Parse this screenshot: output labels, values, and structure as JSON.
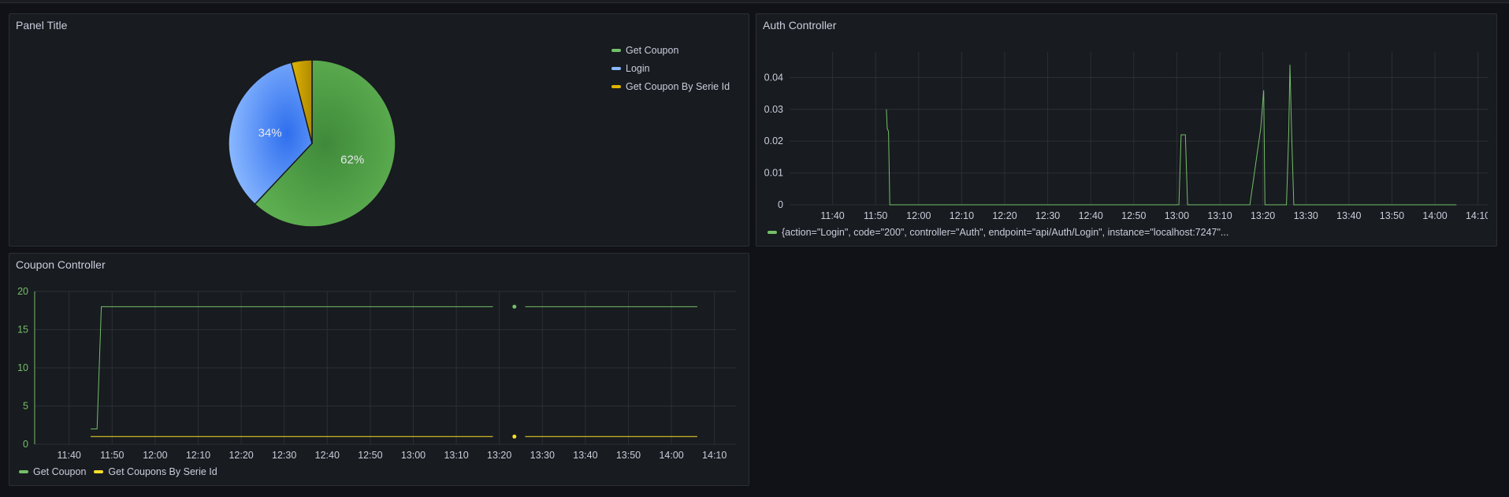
{
  "colors": {
    "green": "#73bf69",
    "blue": "#5794f2",
    "yellow": "#fade2a",
    "grid": "#2c2f36",
    "axisText": "#ccccdc"
  },
  "panels": {
    "pie": {
      "title": "Panel Title",
      "legend": [
        {
          "label": "Get Coupon",
          "color": "#73bf69"
        },
        {
          "label": "Login",
          "color": "#8ab8ff"
        },
        {
          "label": "Get Coupon By Serie Id",
          "color": "#e0b400"
        }
      ]
    },
    "auth": {
      "title": "Auth Controller",
      "legend_label": "{action=\"Login\", code=\"200\", controller=\"Auth\", endpoint=\"api/Auth/Login\", instance=\"localhost:7247\"..."
    },
    "coupon": {
      "title": "Coupon Controller",
      "legend": [
        {
          "label": "Get Coupon",
          "color": "#73bf69"
        },
        {
          "label": "Get Coupons By Serie Id",
          "color": "#fade2a"
        }
      ]
    }
  },
  "chart_data": [
    {
      "type": "pie",
      "title": "Panel Title",
      "series": [
        {
          "name": "Get Coupon",
          "value": 62,
          "label": "62%"
        },
        {
          "name": "Login",
          "value": 34,
          "label": "34%"
        },
        {
          "name": "Get Coupon By Serie Id",
          "value": 4,
          "label": ""
        }
      ]
    },
    {
      "type": "line",
      "title": "Auth Controller",
      "x_ticks": [
        "11:40",
        "11:50",
        "12:00",
        "12:10",
        "12:20",
        "12:30",
        "12:40",
        "12:50",
        "13:00",
        "13:10",
        "13:20",
        "13:30",
        "13:40",
        "13:50",
        "14:00",
        "14:10"
      ],
      "y_ticks": [
        "0",
        "0.01",
        "0.02",
        "0.03",
        "0.04"
      ],
      "ylim": [
        0,
        0.048
      ],
      "xlim_minutes": [
        690,
        853
      ],
      "series": [
        {
          "name": "{action=\"Login\", code=\"200\", controller=\"Auth\", endpoint=\"api/Auth/Login\", instance=\"localhost:7247\"...",
          "points": [
            [
              712.5,
              0.03
            ],
            [
              712.7,
              0.024
            ],
            [
              713.0,
              0.023
            ],
            [
              713.3,
              0
            ],
            [
              780.5,
              0
            ],
            [
              781.0,
              0.022
            ],
            [
              782.0,
              0.022
            ],
            [
              782.5,
              0
            ],
            [
              797.0,
              0
            ],
            [
              799.5,
              0.024
            ],
            [
              800.2,
              0.036
            ],
            [
              800.5,
              0
            ],
            [
              805.5,
              0
            ],
            [
              806.0,
              0.022
            ],
            [
              806.3,
              0.044
            ],
            [
              806.7,
              0.022
            ],
            [
              807.2,
              0
            ],
            [
              845,
              0
            ]
          ]
        }
      ]
    },
    {
      "type": "line",
      "title": "Coupon Controller",
      "x_ticks": [
        "11:40",
        "11:50",
        "12:00",
        "12:10",
        "12:20",
        "12:30",
        "12:40",
        "12:50",
        "13:00",
        "13:10",
        "13:20",
        "13:30",
        "13:40",
        "13:50",
        "14:00",
        "14:10"
      ],
      "y_ticks": [
        "0",
        "5",
        "10",
        "15",
        "20"
      ],
      "ylim": [
        0,
        20
      ],
      "xlim_minutes": [
        692,
        855
      ],
      "series": [
        {
          "name": "Get Coupon",
          "segments": [
            [
              [
                705,
                2
              ],
              [
                706.5,
                2
              ],
              [
                707.5,
                18
              ],
              [
                798.5,
                18
              ]
            ],
            [
              [
                803.5,
                18
              ]
            ],
            [
              [
                806,
                18
              ],
              [
                846,
                18
              ]
            ]
          ]
        },
        {
          "name": "Get Coupons By Serie Id",
          "segments": [
            [
              [
                705,
                1
              ],
              [
                798.5,
                1
              ]
            ],
            [
              [
                803.5,
                1
              ]
            ],
            [
              [
                806,
                1
              ],
              [
                846,
                1
              ]
            ]
          ]
        }
      ]
    }
  ]
}
